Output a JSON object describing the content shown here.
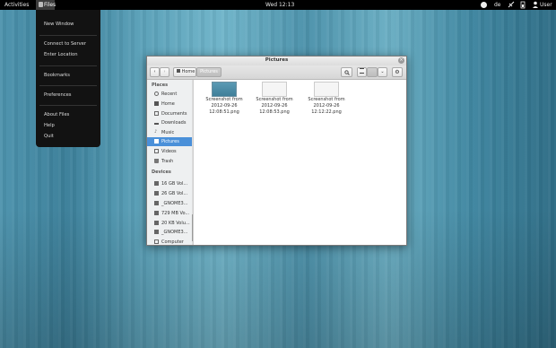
{
  "topbar": {
    "activities": "Activities",
    "app_name": "Files",
    "clock": "Wed 12:13",
    "keyboard_layout": "de",
    "user": "User"
  },
  "app_menu": {
    "items": [
      "New Window",
      "Connect to Server",
      "Enter Location",
      "Bookmarks",
      "Preferences",
      "About Files",
      "Help",
      "Quit"
    ]
  },
  "window": {
    "title": "Pictures",
    "path_home": "Home",
    "path_current": "Pictures"
  },
  "sidebar": {
    "places_header": "Places",
    "places": [
      "Recent",
      "Home",
      "Documents",
      "Downloads",
      "Music",
      "Pictures",
      "Videos",
      "Trash"
    ],
    "selected": "Pictures",
    "devices_header": "Devices",
    "devices": [
      "16 GB Vol...",
      "26 GB Vol...",
      "_GNOME3...",
      "729 MB Vo...",
      "20 KB Volu...",
      "_GNOME3...",
      "Computer"
    ]
  },
  "files": [
    {
      "name_line1": "Screenshot from",
      "name_line2": "2012-09-26",
      "name_line3": "12:08:51.png",
      "thumb": "blue"
    },
    {
      "name_line1": "Screenshot from",
      "name_line2": "2012-09-26",
      "name_line3": "12:08:53.png",
      "thumb": "white"
    },
    {
      "name_line1": "Screenshot from",
      "name_line2": "2012-09-26",
      "name_line3": "12:12:22.png",
      "thumb": "white"
    }
  ],
  "icons": {
    "accessibility": "accessibility-icon",
    "network": "network-icon",
    "volume": "volume-icon",
    "battery": "battery-icon",
    "user": "user-icon",
    "search": "search-icon",
    "view": "view-list-icon",
    "settings": "gear-icon"
  },
  "colors": {
    "selection": "#4a90d9",
    "topbar": "#000000",
    "menu": "#121212"
  }
}
